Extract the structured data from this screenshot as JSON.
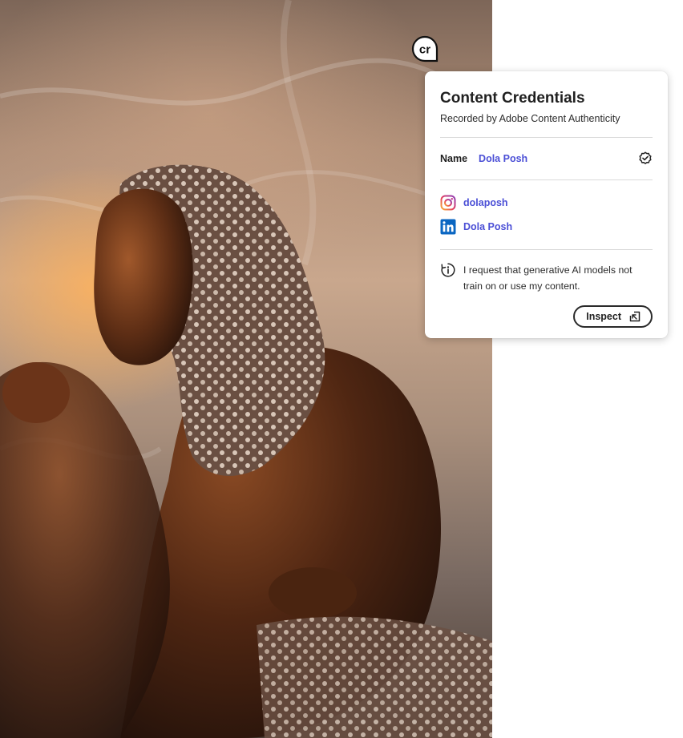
{
  "card": {
    "title": "Content Credentials",
    "subtitle": "Recorded by Adobe Content Authenticity",
    "name_label": "Name",
    "name_value": "Dola Posh",
    "socials": [
      {
        "icon": "instagram-icon",
        "label": "dolaposh"
      },
      {
        "icon": "linkedin-icon",
        "label": "Dola Posh"
      }
    ],
    "ai_notice": "I request that generative AI models not train on or use my content.",
    "inspect_label": "Inspect"
  },
  "badge": {
    "text": "cr"
  },
  "colors": {
    "link": "#4b4fd6",
    "card_bg": "#ffffff",
    "text": "#222222",
    "divider": "#d9d9d9",
    "linkedin": "#0a66c2"
  }
}
